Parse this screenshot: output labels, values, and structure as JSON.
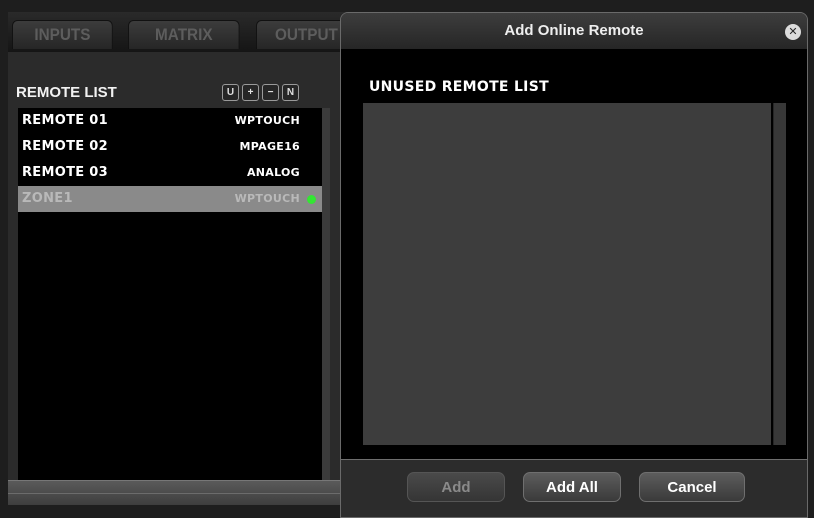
{
  "tabs": [
    {
      "label": "INPUTS"
    },
    {
      "label": "MATRIX"
    },
    {
      "label": "OUTPUT"
    }
  ],
  "remote_panel": {
    "title": "REMOTE LIST",
    "toolbar": [
      "U",
      "+",
      "−",
      "N"
    ],
    "items": [
      {
        "name": "REMOTE 01",
        "type": "WPTOUCH",
        "online": false,
        "selected": false
      },
      {
        "name": "REMOTE 02",
        "type": "MPAGE16",
        "online": false,
        "selected": false
      },
      {
        "name": "REMOTE 03",
        "type": "ANALOG",
        "online": false,
        "selected": false
      },
      {
        "name": "ZONE1",
        "type": "WPTOUCH",
        "online": true,
        "selected": true
      }
    ],
    "status_online_color": "#33e633"
  },
  "dialog": {
    "title": "Add Online Remote",
    "close_icon": "close-icon",
    "list_title": "UNUSED REMOTE LIST",
    "buttons": {
      "add": "Add",
      "add_all": "Add All",
      "cancel": "Cancel"
    }
  }
}
